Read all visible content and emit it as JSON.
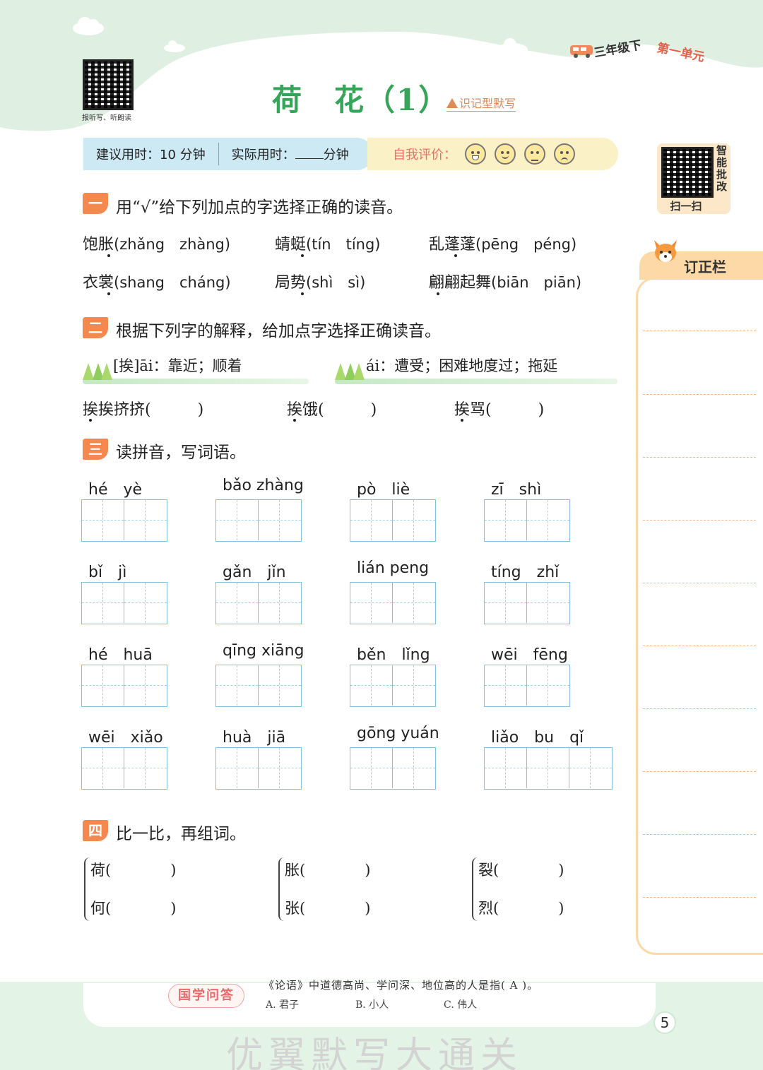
{
  "header": {
    "qr_caption": "报听写、听朗读",
    "grade": "三年级下",
    "unit": "第一单元",
    "title": "荷　花（1）",
    "subtitle": "识记型默写"
  },
  "time_bar": {
    "suggested_label": "建议用时：",
    "suggested_value": "10 分钟",
    "actual_label": "实际用时：",
    "actual_unit": "分钟",
    "self_eval_label": "自我评价："
  },
  "side": {
    "smart_label": [
      "智",
      "能",
      "批",
      "改"
    ],
    "scan_label": "扫一扫",
    "correction_title": "订正栏"
  },
  "section1": {
    "badge": "一",
    "title": "用“√”给下列加点的字选择正确的读音。",
    "row1": [
      {
        "word": "饱胀",
        "options": "(zhǎng　zhàng)"
      },
      {
        "word": "蜻蜓",
        "options": "(tín　tíng)"
      },
      {
        "word": "乱蓬蓬",
        "options": "(pēng　péng)"
      }
    ],
    "row2": [
      {
        "word": "衣裳",
        "options": "(shang　cháng)"
      },
      {
        "word": "局势",
        "options": "(shì　sì)"
      },
      {
        "word": "翩翩起舞",
        "options": "(biān　piān)"
      }
    ]
  },
  "section2": {
    "badge": "二",
    "title": "根据下列字的解释，给加点字选择正确读音。",
    "def1": "[挨]āi：靠近；顺着",
    "def2": "ái：遭受；困难地度过；拖延",
    "items": [
      "挨挨挤挤(　　　)",
      "挨饿(　　　)",
      "挨骂(　　　)"
    ]
  },
  "section3": {
    "badge": "三",
    "title": "读拼音，写词语。",
    "rows": [
      [
        {
          "py": "hé　yè",
          "n": 2
        },
        {
          "py": "bǎo zhàng",
          "n": 2
        },
        {
          "py": "pò　liè",
          "n": 2
        },
        {
          "py": "zī　shì",
          "n": 2
        }
      ],
      [
        {
          "py": "bǐ　jì",
          "n": 2
        },
        {
          "py": "gǎn　jǐn",
          "n": 2
        },
        {
          "py": "lián peng",
          "n": 2
        },
        {
          "py": "tíng　zhǐ",
          "n": 2
        }
      ],
      [
        {
          "py": "hé　huā",
          "n": 2
        },
        {
          "py": "qīng xiāng",
          "n": 2
        },
        {
          "py": "běn　lǐng",
          "n": 2
        },
        {
          "py": "wēi　fēng",
          "n": 2
        }
      ],
      [
        {
          "py": "wēi　xiǎo",
          "n": 2
        },
        {
          "py": "huà　jiā",
          "n": 2
        },
        {
          "py": "gōng yuán",
          "n": 2
        },
        {
          "py": "liǎo　bu　qǐ",
          "n": 3
        }
      ]
    ]
  },
  "section4": {
    "badge": "四",
    "title": "比一比，再组词。",
    "pairs": [
      [
        "荷(　　　　)",
        "何(　　　　)"
      ],
      [
        "胀(　　　　)",
        "张(　　　　)"
      ],
      [
        "裂(　　　　)",
        "烈(　　　　)"
      ]
    ]
  },
  "footer": {
    "badge": "国学问答",
    "question": "《论语》中道德高尚、学问深、地位高的人是指( A )。",
    "options": [
      "A. 君子",
      "B. 小人",
      "C. 伟人"
    ],
    "page": "5",
    "brand": "优翼默写大通关"
  },
  "colors": {
    "accent_green": "#35a55a",
    "accent_orange": "#f5884f",
    "grid_blue": "#7fc5e3",
    "wave_green": "#dff0e3"
  }
}
